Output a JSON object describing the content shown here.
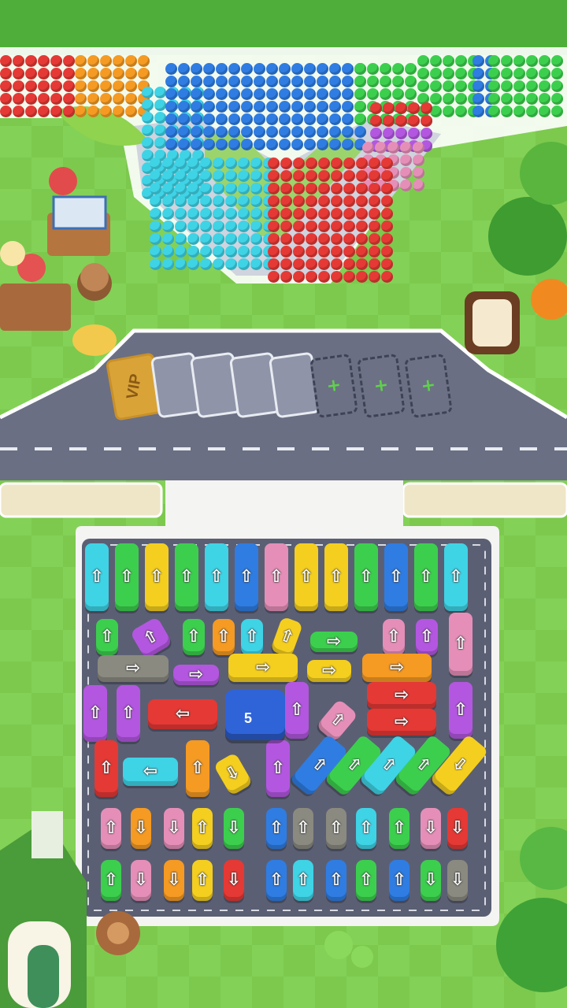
{
  "game": {
    "vip_label": "VIP",
    "queue_count": 4,
    "locked_slots": 3,
    "boss_truck_number": "5",
    "add_slot_symbol": "+"
  },
  "colors": {
    "grass": "#7cc94e",
    "road": "#6a6f84",
    "lot": "#5b5f74",
    "red": "#e53935",
    "orange": "#f59a23",
    "yellow": "#f4cf1f",
    "green": "#3ccf4e",
    "cyan": "#3fd3e6",
    "blue": "#2f7de2",
    "purple": "#b357e0",
    "pink": "#e58fb8",
    "gray": "#8a8a80"
  },
  "crowd_colors": [
    "red",
    "orange",
    "cyan",
    "blue",
    "green",
    "purple",
    "pink",
    "red",
    "green",
    "blue"
  ]
}
